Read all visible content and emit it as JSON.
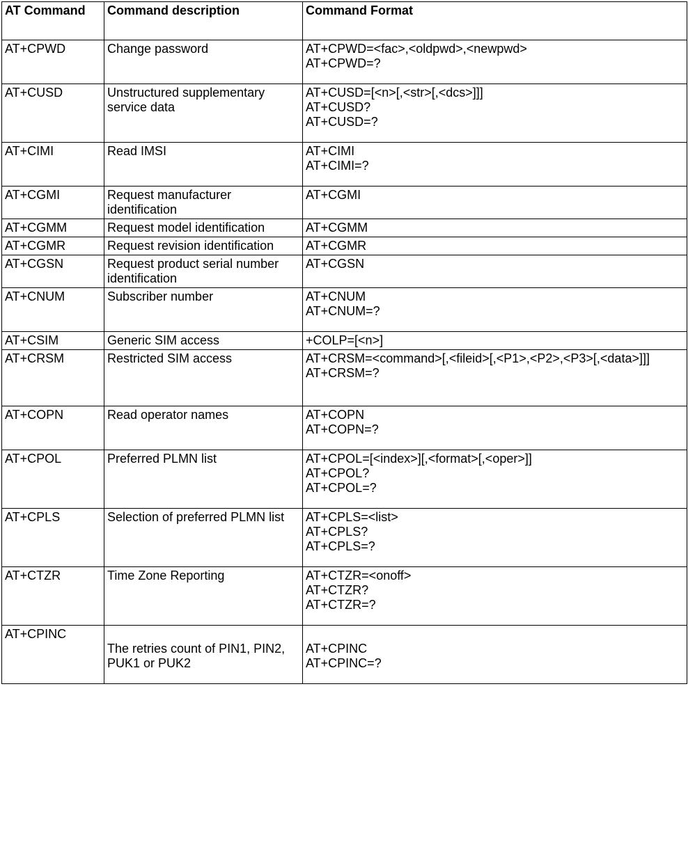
{
  "headers": {
    "col1": "AT Command",
    "col2": "Command description",
    "col3": "Command Format"
  },
  "rows": [
    {
      "cmd": "AT+CPWD",
      "desc": "Change password",
      "fmt": "AT+CPWD=<fac>,<oldpwd>,<newpwd>\nAT+CPWD=?",
      "padb": true
    },
    {
      "cmd": "AT+CUSD",
      "desc": "Unstructured supplementary service data",
      "fmt": "AT+CUSD=[<n>[,<str>[,<dcs>]]]\nAT+CUSD?\nAT+CUSD=?",
      "padb": true
    },
    {
      "cmd": "AT+CIMI",
      "desc": "Read IMSI",
      "fmt": "AT+CIMI\nAT+CIMI=?",
      "padb": true
    },
    {
      "cmd": "AT+CGMI",
      "desc": "Request manufacturer identification",
      "fmt": "AT+CGMI"
    },
    {
      "cmd": "AT+CGMM",
      "desc": "Request model identification",
      "fmt": "AT+CGMM"
    },
    {
      "cmd": "AT+CGMR",
      "desc": "Request revision identification",
      "fmt": "AT+CGMR"
    },
    {
      "cmd": "AT+CGSN",
      "desc": "Request product serial number identification",
      "fmt": "AT+CGSN"
    },
    {
      "cmd": "AT+CNUM",
      "desc": "Subscriber number",
      "fmt": "AT+CNUM\nAT+CNUM=?",
      "padb": true
    },
    {
      "cmd": "AT+CSIM",
      "desc": "Generic SIM access",
      "fmt": "+COLP=[<n>]"
    },
    {
      "cmd": "AT+CRSM",
      "desc": "Restricted SIM access",
      "fmt": "AT+CRSM=<command>[,<fileid>[,<P1>,<P2>,<P3>[,<data>]]]\nAT+CRSM=?",
      "padb2": true
    },
    {
      "cmd": "AT+COPN",
      "desc": "Read operator names",
      "fmt": "AT+COPN\nAT+COPN=?",
      "padb": true
    },
    {
      "cmd": "AT+CPOL",
      "desc": "Preferred PLMN list",
      "fmt": "AT+CPOL=[<index>][,<format>[,<oper>]]\nAT+CPOL?\nAT+CPOL=?",
      "padb": true
    },
    {
      "cmd": "AT+CPLS",
      "desc": "Selection of preferred PLMN list",
      "fmt": "AT+CPLS=<list>\nAT+CPLS?\nAT+CPLS=?",
      "padb": true
    },
    {
      "cmd": "AT+CTZR",
      "desc": "Time Zone Reporting",
      "fmt": "AT+CTZR=<onoff>\nAT+CTZR?\nAT+CTZR=?",
      "padb": true
    },
    {
      "cmd": "AT+CPINC",
      "desc": "\nThe retries count of PIN1, PIN2, PUK1 or PUK2",
      "fmt": "\nAT+CPINC\nAT+CPINC=?",
      "padb": true
    }
  ]
}
